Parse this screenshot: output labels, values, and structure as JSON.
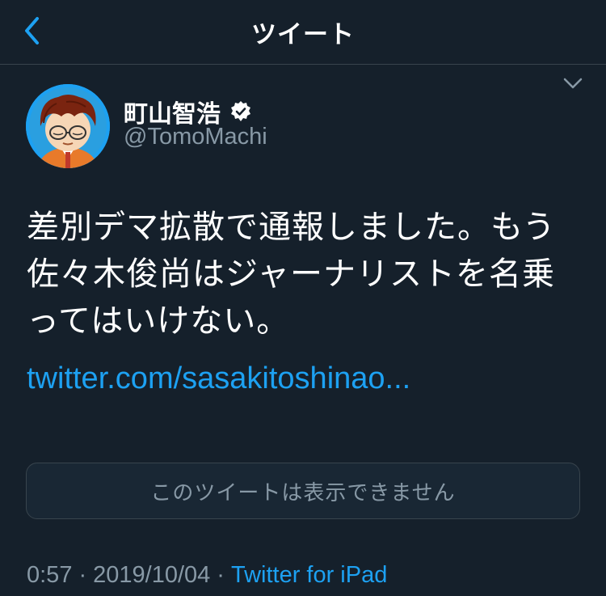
{
  "nav": {
    "title": "ツイート",
    "back_icon": "chevron-left-icon"
  },
  "tweet": {
    "author": {
      "display_name": "町山智浩",
      "handle": "@TomoMachi",
      "verified": true
    },
    "text": "差別デマ拡散で通報しました。もう佐々木俊尚はジャーナリストを名乗ってはいけない。",
    "link": "twitter.com/sasakitoshinao...",
    "quoted_tweet_unavailable": "このツイートは表示できません",
    "time": "0:57",
    "date": "2019/10/04",
    "separator": "·",
    "source": "Twitter for iPad"
  },
  "colors": {
    "background": "#15202b",
    "accent": "#1da1f2",
    "secondary_text": "#8899a6",
    "border": "#38444d"
  }
}
